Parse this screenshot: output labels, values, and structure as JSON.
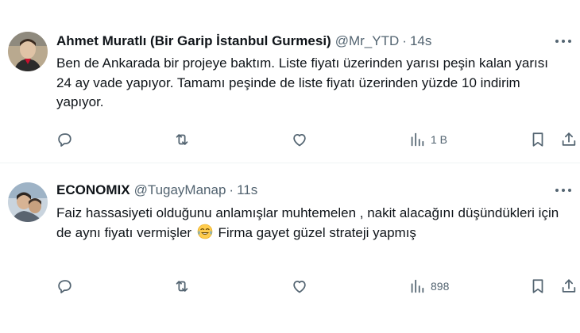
{
  "tweets": [
    {
      "author_name": "Ahmet Muratlı (Bir Garip İstanbul Gurmesi)",
      "handle": "@Mr_YTD",
      "separator": "·",
      "time": "14s",
      "text": "Ben de Ankarada bir projeye baktım. Liste fiyatı üzerinden yarısı peşin kalan yarısı 24 ay vade yapıyor. Tamamı peşinde de liste fiyatı üzerinden yüzde 10 indirim yapıyor.",
      "views": "1 B"
    },
    {
      "author_name": "ECONOMIX",
      "handle": "@TugayManap",
      "separator": "·",
      "time": "11s",
      "text_before_emoji": "Faiz hassasiyeti olduğunu anlamışlar muhtemelen , nakit alacağını düşündükleri için de aynı fiyatı vermişler ",
      "emoji_name": "face-with-tears-of-joy-icon",
      "text_after_emoji": " Firma gayet güzel strateji yapmış",
      "views": "898"
    }
  ],
  "icons": [
    "more-icon",
    "reply-icon",
    "retweet-icon",
    "like-icon",
    "views-icon",
    "bookmark-icon",
    "share-icon"
  ],
  "colors": {
    "text_primary": "#0f1419",
    "text_secondary": "#536471",
    "divider": "#eff3f4",
    "background": "#ffffff"
  }
}
